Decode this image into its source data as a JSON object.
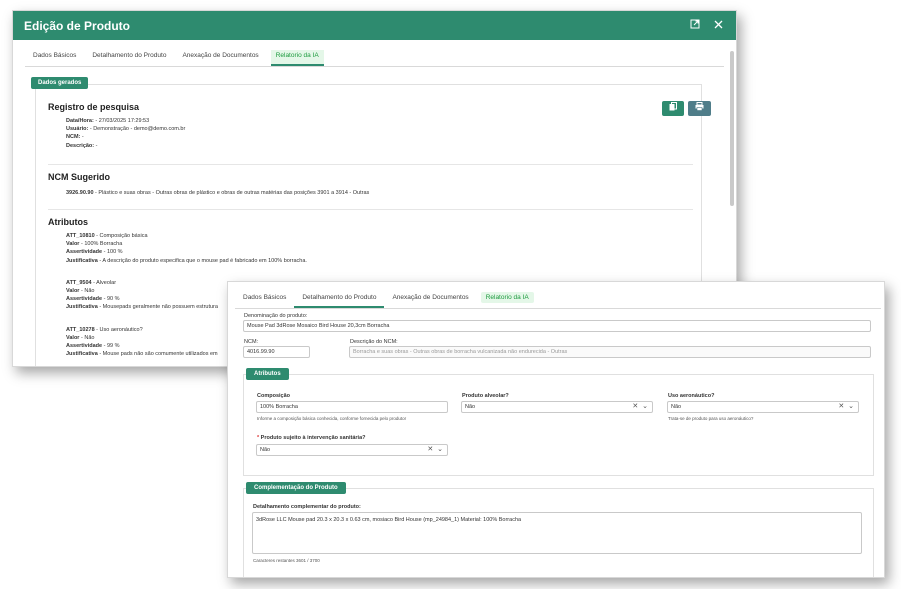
{
  "window1": {
    "title": "Edição de Produto",
    "tabs": [
      "Dados Básicos",
      "Detalhamento do Produto",
      "Anexação de Documentos",
      "Relatorio da IA"
    ],
    "generated_pill": "Dados gerados",
    "registro": {
      "heading": "Registro de pesquisa",
      "datahora_label": "Data/Hora:",
      "datahora_value": " - 27/03/2025 17:29:53",
      "usuario_label": "Usuário:",
      "usuario_value": " - Demonstração - demo@demo.com.br",
      "ncm_label": "NCM:",
      "ncm_value": " -",
      "descricao_label": "Descrição:",
      "descricao_value": " -"
    },
    "ncm_sugerido": {
      "heading": "NCM Sugerido",
      "code": "3926.90.90",
      "text": " - Plástico e suas obras - Outras obras de plástico e obras de outras matérias das posições 3901 a 3914 - Outras"
    },
    "atributos": {
      "heading": "Atributos",
      "items": [
        {
          "code": "ATT_10810",
          "name": " - Composição básica",
          "valor_label": "Valor",
          "valor": " - 100% Borracha",
          "assert_label": "Assertividade",
          "assert": " - 100 %",
          "just_label": "Justificativa",
          "just": " - A descrição do produto especifica que o mouse pad é fabricado em 100% borracha."
        },
        {
          "code": "ATT_9504",
          "name": " - Alveolar",
          "valor_label": "Valor",
          "valor": " - Não",
          "assert_label": "Assertividade",
          "assert": " - 90 %",
          "just_label": "Justificativa",
          "just": " - Mousepads geralmente não possuem estrutura"
        },
        {
          "code": "ATT_10278",
          "name": " - Uso aeronáutico?",
          "valor_label": "Valor",
          "valor": " - Não",
          "assert_label": "Assertividade",
          "assert": " - 99 %",
          "just_label": "Justificativa",
          "just": " - Mouse pads não são comumente utilizados em"
        }
      ]
    }
  },
  "window2": {
    "tabs": [
      "Dados Básicos",
      "Detalhamento do Produto",
      "Anexação de Documentos",
      "Relatorio da IA"
    ],
    "denominacao_label": "Denominação do produto:",
    "denominacao_value": "Mouse Pad 3dRose Mosaico Bird House 20,3cm Borracha",
    "ncm_label": "NCM:",
    "ncm_value": "4016.99.90",
    "desc_ncm_label": "Descrição do NCM:",
    "desc_ncm_value": "Borracha e suas obras - Outras obras de borracha vulcanizada não endurecida - Outras",
    "atributos_pill": "Atributos",
    "composicao_label": "Composição",
    "composicao_value": "100% Borracha",
    "composicao_hint": "Informe a composição básica conhecida, conforme fornecida pelo produtor",
    "alveolar_label": "Produto alveolar?",
    "alveolar_value": "Não",
    "aero_label": "Uso aeronáutico?",
    "aero_value": "Não",
    "aero_hint": "Trata-se de produto para uso aeronáutico?",
    "sanit_label": "Produto sujeito à intervenção sanitária?",
    "sanit_value": "Não",
    "complementacao_pill": "Complementação do Produto",
    "detalhamento_label": "Detalhamento complementar do produto:",
    "detalhamento_value": "3dRose LLC Mouse pad 20.3 x 20.3 x 0.63 cm, mosiaco Bird House (mp_24984_1) Material: 100% Borracha",
    "chars_remaining": "Caracteres restantes 3601 / 3700"
  },
  "colors": {
    "primary": "#2e8b6f",
    "ai_tab_bg": "#e4f7e8",
    "ai_tab_text": "#1c9a3d",
    "print_btn": "#4f7d89"
  },
  "icons": [
    "popout-icon",
    "close-icon",
    "copy-icon",
    "print-icon",
    "clear-x-icon",
    "chevron-down-icon"
  ]
}
